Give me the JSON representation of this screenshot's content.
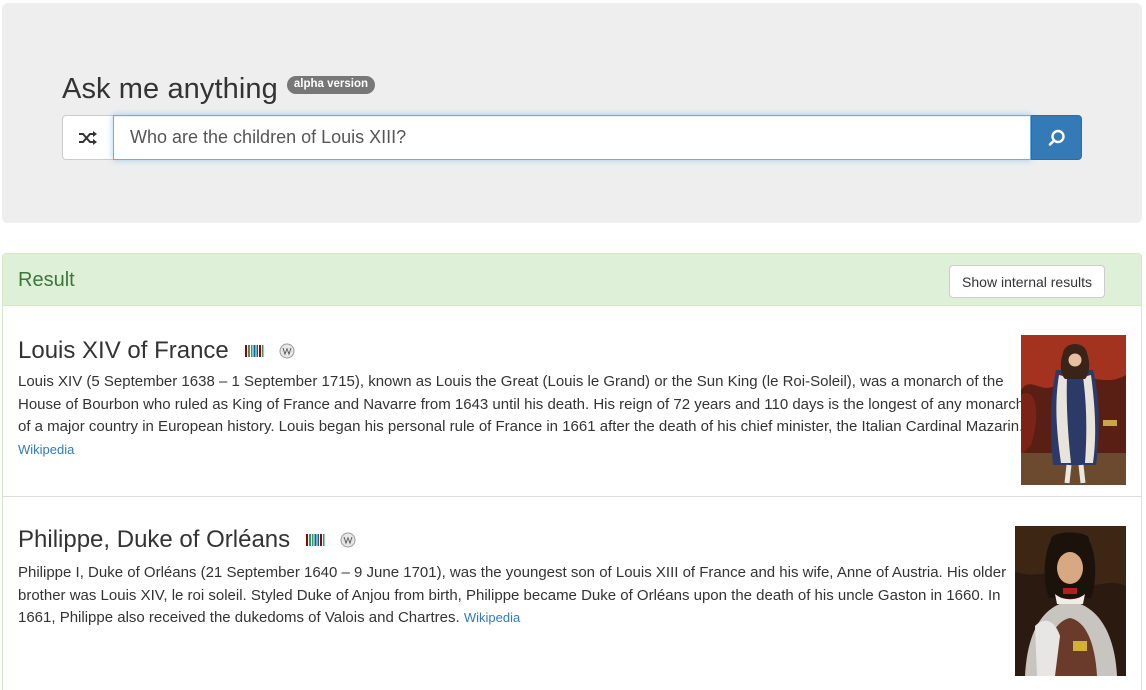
{
  "header": {
    "title": "Ask me anything",
    "badge": "alpha version"
  },
  "search": {
    "value": "Who are the children of Louis XIII?",
    "shuffle_icon": "shuffle-icon",
    "search_icon": "search-icon"
  },
  "result_panel": {
    "title": "Result",
    "internal_button": "Show internal results",
    "entries": [
      {
        "title": "Louis XIV of France",
        "description": "Louis XIV (5 September 1638 – 1 September 1715), known as Louis the Great (Louis le Grand) or the Sun King (le Roi-Soleil), was a monarch of the House of Bourbon who ruled as King of France and Navarre from 1643 until his death. His reign of 72 years and 110 days is the longest of any monarch of a major country in European history. Louis began his personal rule of France in 1661 after the death of his chief minister, the Italian Cardinal Mazarin.",
        "link": "Wikipedia",
        "icons": [
          "wikidata-icon",
          "wikipedia-icon"
        ],
        "image": "portrait-louis-xiv"
      },
      {
        "title": "Philippe, Duke of Orléans",
        "description": "Philippe I, Duke of Orléans (21 September 1640 – 9 June 1701), was the youngest son of Louis XIII of France and his wife, Anne of Austria. His older brother was Louis XIV, le roi soleil. Styled Duke of Anjou from birth, Philippe became Duke of Orléans upon the death of his uncle Gaston in 1660. In 1661, Philippe also received the dukedoms of Valois and Chartres.",
        "link": "Wikipedia",
        "icons": [
          "wikidata-icon",
          "wikipedia-icon"
        ],
        "image": "portrait-philippe"
      }
    ]
  },
  "colors": {
    "primary": "#337ab7",
    "success_bg": "#dff0d8",
    "success_text": "#3c763d",
    "jumbotron_bg": "#eeeeee",
    "badge_bg": "#777777"
  }
}
